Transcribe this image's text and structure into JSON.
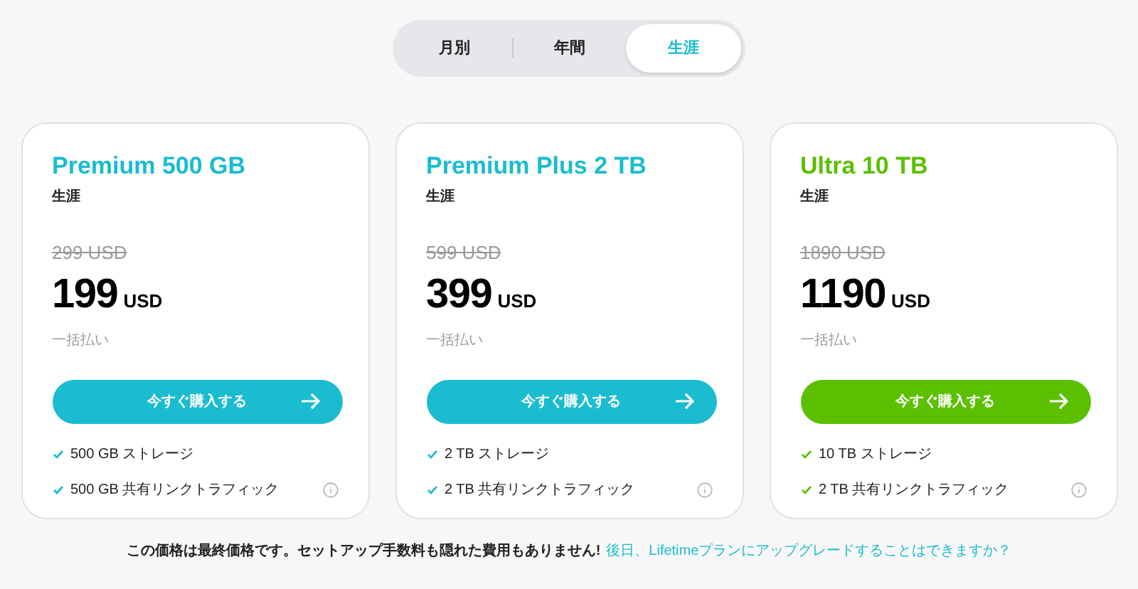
{
  "period_tabs": [
    {
      "label": "月別",
      "selected": false
    },
    {
      "label": "年間",
      "selected": false
    },
    {
      "label": "生涯",
      "selected": true
    }
  ],
  "plans": [
    {
      "name": "Premium 500 GB",
      "color": "#1bbccf",
      "period": "生涯",
      "old_price": "299 USD",
      "price": "199",
      "currency": "USD",
      "payment": "一括払い",
      "button": "今すぐ購入する",
      "features": [
        {
          "text": "500 GB ストレージ",
          "info": false
        },
        {
          "text": "500 GB 共有リンクトラフィック",
          "info": true
        }
      ]
    },
    {
      "name": "Premium Plus 2 TB",
      "color": "#1bbccf",
      "period": "生涯",
      "old_price": "599 USD",
      "price": "399",
      "currency": "USD",
      "payment": "一括払い",
      "button": "今すぐ購入する",
      "features": [
        {
          "text": "2 TB ストレージ",
          "info": false
        },
        {
          "text": "2 TB 共有リンクトラフィック",
          "info": true
        }
      ]
    },
    {
      "name": "Ultra 10 TB",
      "color": "#5cbf00",
      "period": "生涯",
      "old_price": "1890 USD",
      "price": "1190",
      "currency": "USD",
      "payment": "一括払い",
      "button": "今すぐ購入する",
      "features": [
        {
          "text": "10 TB ストレージ",
          "info": false
        },
        {
          "text": "2 TB 共有リンクトラフィック",
          "info": true
        }
      ]
    }
  ],
  "footer": {
    "text": "この価格は最終価格です。セットアップ手数料も隠れた費用もありません!",
    "link": "後日、Lifetimeプランにアップグレードすることはできますか？"
  }
}
